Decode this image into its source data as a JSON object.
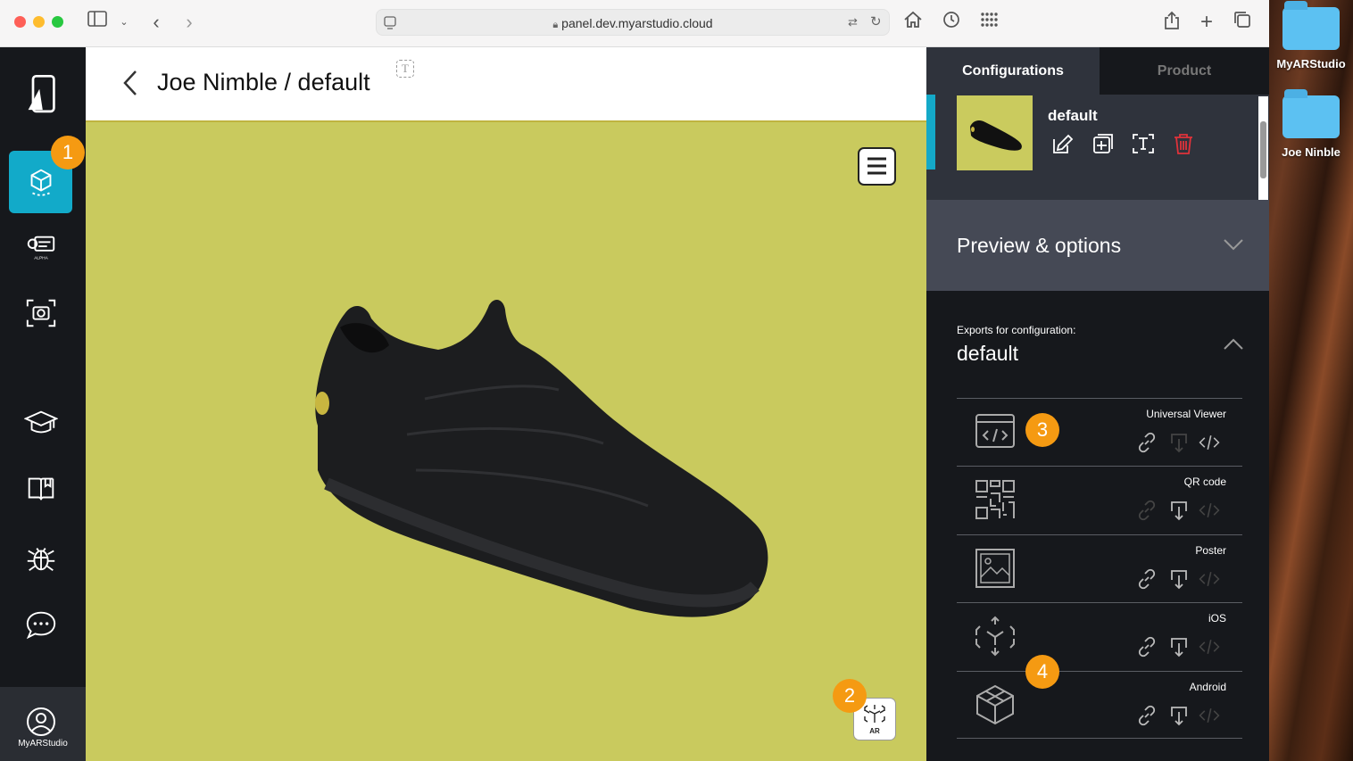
{
  "browser": {
    "url": "panel.dev.myarstudio.cloud"
  },
  "desktop": {
    "folders": [
      "MyARStudio",
      "Joe Ninble"
    ]
  },
  "sidebar": {
    "account_label": "MyARStudio",
    "alpha_label": "ALPHA"
  },
  "header": {
    "title": "Joe Nimble / default",
    "t_icon": "T"
  },
  "viewer": {
    "ar_label": "AR"
  },
  "badges": [
    "1",
    "2",
    "3",
    "4"
  ],
  "panel": {
    "tabs": [
      "Configurations",
      "Product"
    ],
    "config_name": "default",
    "preview_label": "Preview & options",
    "exports_caption": "Exports for configuration:",
    "exports_config": "default",
    "exports": [
      {
        "name": "Universal Viewer",
        "icon": "code-window-icon"
      },
      {
        "name": "QR code",
        "icon": "qr-code-icon"
      },
      {
        "name": "Poster",
        "icon": "image-icon"
      },
      {
        "name": "iOS",
        "icon": "ar-cube-icon"
      },
      {
        "name": "Android",
        "icon": "3d-box-icon"
      }
    ]
  },
  "colors": {
    "accent": "#14a9c8",
    "viewer_bg": "#c9ca5e",
    "badge": "#f59a12",
    "delete": "#e0323a"
  }
}
